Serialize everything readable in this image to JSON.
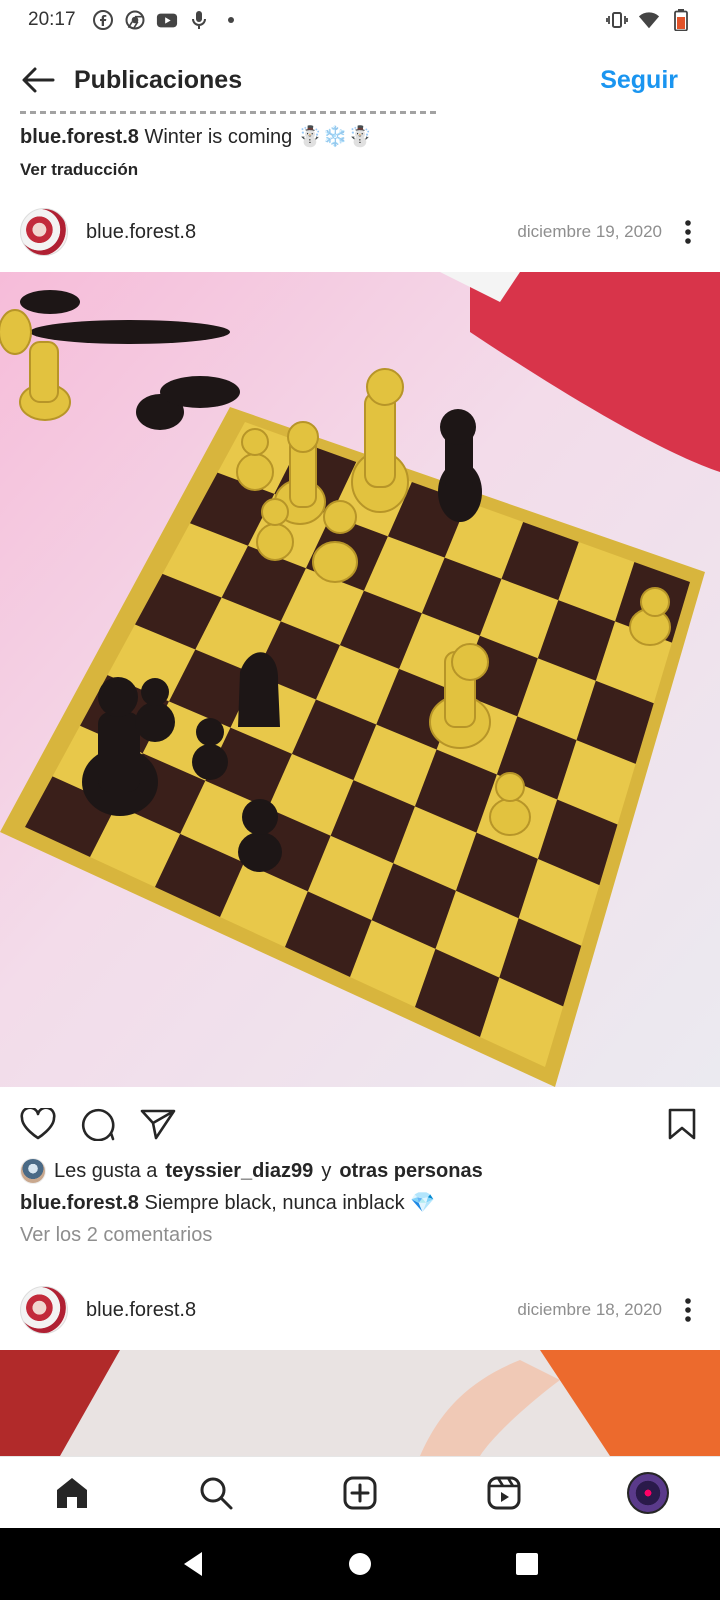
{
  "status_bar": {
    "time": "20:17",
    "left_icons": [
      "facebook-icon",
      "chrome-icon",
      "youtube-icon",
      "microphone-icon",
      "dot-icon"
    ],
    "right_icons": [
      "vibrate-icon",
      "wifi-icon",
      "battery-icon"
    ]
  },
  "header": {
    "title": "Publicaciones",
    "follow_label": "Seguir"
  },
  "previous_post": {
    "username": "blue.forest.8",
    "caption": "Winter is coming ☃️❄️☃️",
    "translate_label": "Ver traducción"
  },
  "post": {
    "username": "blue.forest.8",
    "date": "diciembre 19, 2020",
    "image_description_icon": "chessboard-photo",
    "likes_prefix": "Les gusta a",
    "likes_user": "teyssier_diaz99",
    "likes_connector": "y",
    "likes_suffix": "otras personas",
    "caption": "Siempre black, nunca inblack 💎",
    "comments_label": "Ver los 2 comentarios"
  },
  "next_post": {
    "username": "blue.forest.8",
    "date": "diciembre 18, 2020"
  },
  "bottom_nav": [
    "home-icon",
    "search-icon",
    "create-icon",
    "reels-icon",
    "profile-avatar"
  ],
  "system_nav": [
    "back-icon",
    "home-circle-icon",
    "recents-icon"
  ],
  "colors": {
    "accent": "#1a95f0",
    "text": "#262626",
    "muted": "#8e8e8e"
  }
}
